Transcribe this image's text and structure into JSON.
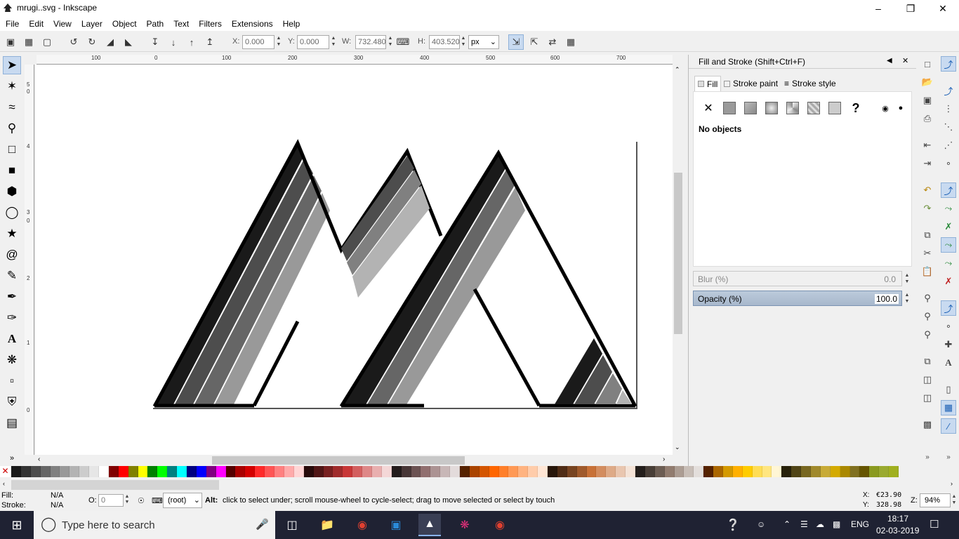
{
  "window": {
    "title": "mrugi..svg - Inkscape"
  },
  "menu": [
    "File",
    "Edit",
    "View",
    "Layer",
    "Object",
    "Path",
    "Text",
    "Filters",
    "Extensions",
    "Help"
  ],
  "toolbar": {
    "x_label": "X:",
    "x_value": "0.000",
    "y_label": "Y:",
    "y_value": "0.000",
    "w_label": "W:",
    "w_value": "732.480",
    "h_label": "H:",
    "h_value": "403.520",
    "unit": "px"
  },
  "ruler_h": [
    "100",
    "0",
    "100",
    "200",
    "300",
    "400",
    "500",
    "600",
    "700"
  ],
  "ruler_v": [
    "5",
    "0",
    "4",
    "3",
    "0",
    "2",
    "1",
    "0"
  ],
  "panel": {
    "title": "Fill and Stroke (Shift+Ctrl+F)",
    "tabs": [
      "Fill",
      "Stroke paint",
      "Stroke style"
    ],
    "no_objects": "No objects",
    "blur_label": "Blur (%)",
    "blur_value": "0.0",
    "opacity_label": "Opacity (%)",
    "opacity_value": "100.0"
  },
  "status": {
    "fill_label": "Fill:",
    "fill_value": "N/A",
    "stroke_label": "Stroke:",
    "stroke_value": "N/A",
    "o_label": "O:",
    "o_value": "0",
    "layer": "(root)",
    "message_bold": "Alt:",
    "message": " click to select under; scroll mouse-wheel to cycle-select; drag to move selected or select by touch",
    "cx_label": "X:",
    "cx": "€23.90",
    "cy_label": "Y:",
    "cy": "328.98",
    "zoom_label": "Z:",
    "zoom": "94%"
  },
  "taskbar": {
    "search_placeholder": "Type here to search",
    "lang": "ENG",
    "time": "18:17",
    "date": "02-03-2019"
  },
  "palette": [
    "#1a1a1a",
    "#333333",
    "#4d4d4d",
    "#666666",
    "#808080",
    "#999999",
    "#b3b3b3",
    "#cccccc",
    "#e6e6e6",
    "#ffffff",
    "#800000",
    "#ff0000",
    "#808000",
    "#ffff00",
    "#008000",
    "#00ff00",
    "#008080",
    "#00ffff",
    "#000080",
    "#0000ff",
    "#800080",
    "#ff00ff",
    "#550000",
    "#aa0000",
    "#d40000",
    "#ff2a2a",
    "#ff5555",
    "#ff8080",
    "#ffaaaa",
    "#ffd5d5",
    "#280b0b",
    "#501616",
    "#782121",
    "#a02c2c",
    "#c83737",
    "#d35f5f",
    "#de8787",
    "#e9afaf",
    "#f4d7d7",
    "#241c1c",
    "#483737",
    "#6c5353",
    "#916f6f",
    "#ac9393",
    "#c8b7b7",
    "#e3dbdb",
    "#552200",
    "#aa4400",
    "#d45500",
    "#ff6600",
    "#ff7f2a",
    "#ff9955",
    "#ffb380",
    "#ffccaa",
    "#ffe6d5",
    "#28170b",
    "#502d16",
    "#784421",
    "#a05a2c",
    "#c87137",
    "#d38d5f",
    "#deaa87",
    "#e9c6af",
    "#f4e3d7",
    "#241f1c",
    "#483e37",
    "#6c5d53",
    "#917c6f",
    "#ac9d93",
    "#c8beb7",
    "#e3dedb",
    "#552200",
    "#aa6600",
    "#d49900",
    "#ffb000",
    "#ffcc00",
    "#ffdd55",
    "#ffe680",
    "#fff6d5",
    "#28220b",
    "#504416",
    "#786721",
    "#a0892c",
    "#c8ab37",
    "#d4aa00",
    "#aa8800",
    "#807020",
    "#665500",
    "#8a9a20",
    "#9aaa30",
    "#a0b020"
  ],
  "colors": {
    "accent": "#c8daf0",
    "taskbar": "#1f2233"
  }
}
